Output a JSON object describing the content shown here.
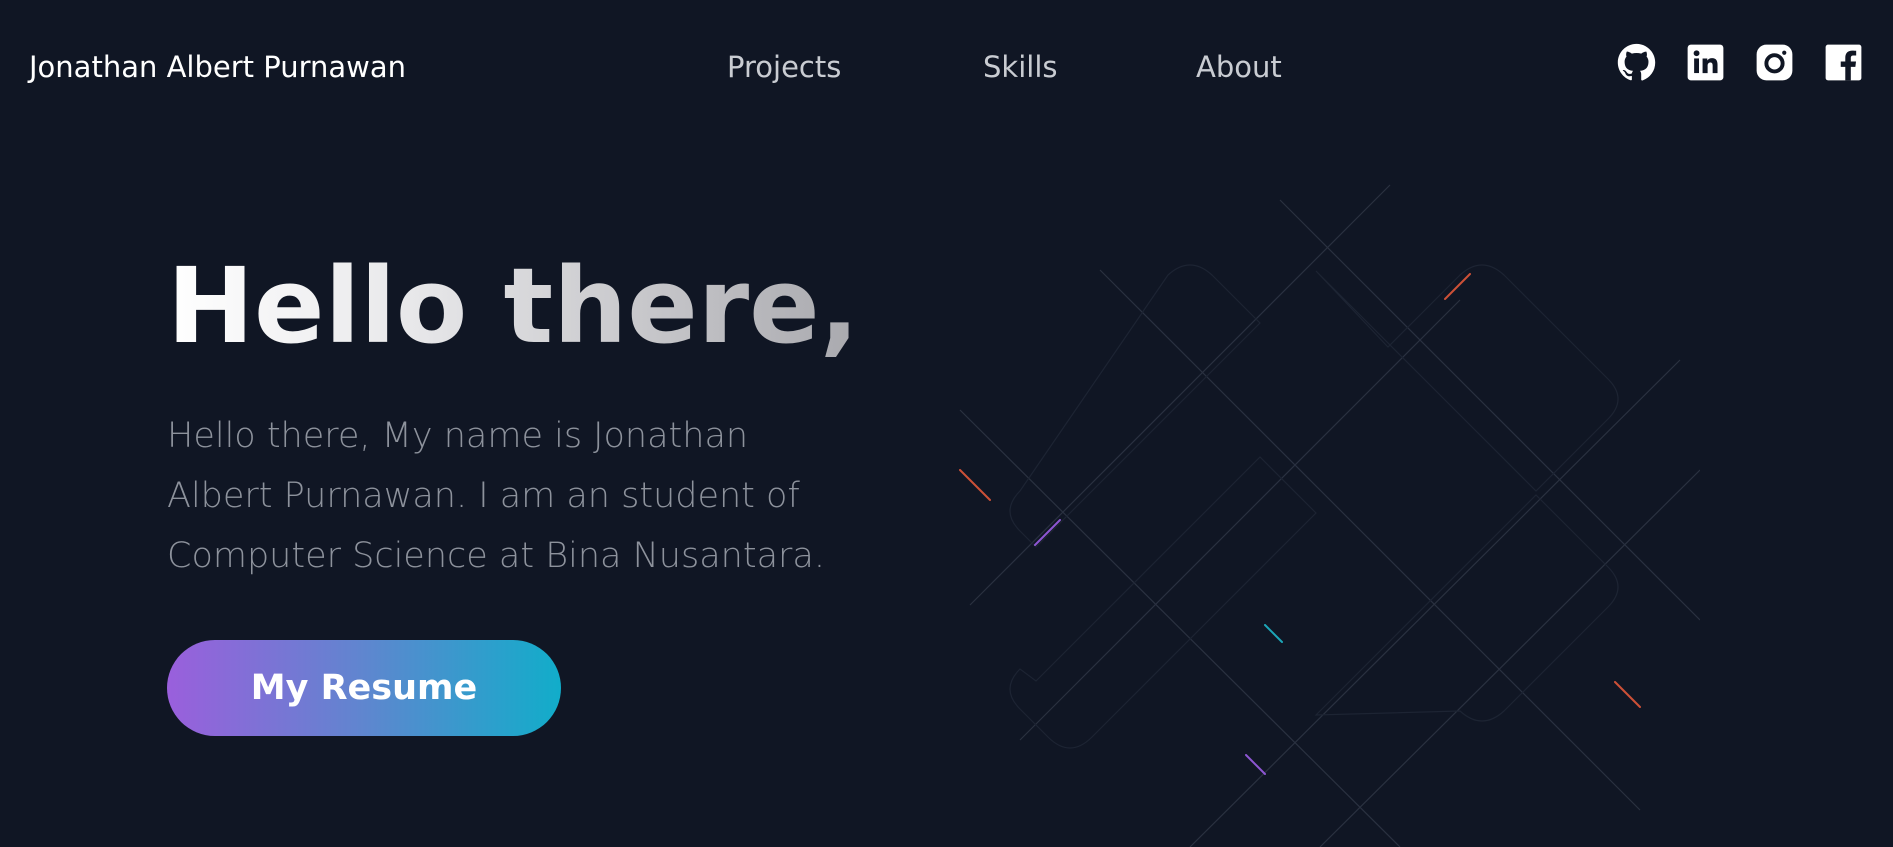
{
  "header": {
    "brand": "Jonathan Albert Purnawan",
    "nav": [
      "Projects",
      "Skills",
      "About"
    ],
    "social_icons": [
      "github-icon",
      "linkedin-icon",
      "instagram-icon",
      "facebook-icon"
    ]
  },
  "hero": {
    "title": "Hello there,",
    "description": "Hello there, My name is Jonathan Albert Purnawan. I am an student of Computer Science at Bina Nusantara.",
    "button_label": "My Resume"
  },
  "colors": {
    "background": "#101624",
    "button_gradient_start": "#9a5fdc",
    "button_gradient_end": "#11adca",
    "accent_orange": "#e2573a",
    "accent_purple": "#9b5de5",
    "accent_cyan": "#1fb6c9"
  }
}
